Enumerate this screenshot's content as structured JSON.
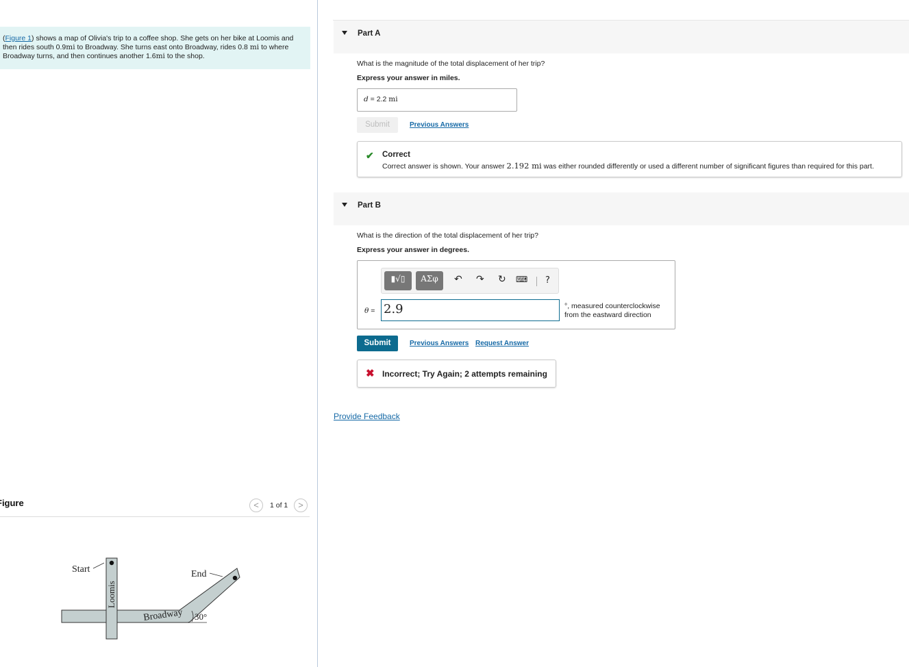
{
  "problem": {
    "link_text": "Figure 1",
    "open_paren": "(",
    "text_1": ") shows a map of Olivia's trip to a coffee shop. She gets on her bike at Loomis and then rides south 0.9",
    "unit_mi_1": "mi",
    "text_2": " to Broadway. She turns east onto Broadway, rides 0.8 ",
    "unit_mi_2": "mi",
    "text_3": " to where Broadway turns, and then continues another 1.6",
    "unit_mi_3": "mi",
    "text_4": " to the shop."
  },
  "figure": {
    "title": "Figure",
    "counter": "1 of 1",
    "prev_icon": "<",
    "next_icon": ">",
    "labels": {
      "start": "Start",
      "end": "End",
      "loomis": "Loomis",
      "broadway": "Broadway",
      "angle": "30°"
    }
  },
  "partA": {
    "title": "Part A",
    "question": "What is the magnitude of the total displacement of her trip?",
    "instruction": "Express your answer in miles.",
    "var": "d",
    "eq": " = ",
    "value": "2.2",
    "unit": "mi",
    "submit_label": "Submit",
    "previous_answers_label": "Previous Answers",
    "result_title": "Correct",
    "result_msg_1": "Correct answer is shown. Your answer ",
    "result_value": "2.192 mi",
    "result_msg_2": " was either rounded differently or used a different number of significant figures than required for this part."
  },
  "partB": {
    "title": "Part B",
    "question": "What is the direction of the total displacement of her trip?",
    "instruction": "Express your answer in degrees.",
    "toolbar": {
      "template_label": "▮√▯",
      "greek_label": "ΑΣφ",
      "undo_icon": "↶",
      "redo_icon": "↷",
      "reset_icon": "↻",
      "keyboard_icon": "⌨",
      "help_label": "?"
    },
    "var": "θ",
    "eq": " = ",
    "value": "2.9",
    "unit_text": "°, measured counterclockwise from the eastward direction",
    "submit_label": "Submit",
    "previous_answers_label": "Previous Answers",
    "request_answer_label": "Request Answer",
    "result_msg": "Incorrect; Try Again; 2 attempts remaining"
  },
  "feedback_label": "Provide Feedback",
  "colors": {
    "accent": "#0d6b8f",
    "link": "#1569a6",
    "correct": "#2a8a2a",
    "incorrect": "#c8102e",
    "problem_bg": "#e2f4f4"
  }
}
